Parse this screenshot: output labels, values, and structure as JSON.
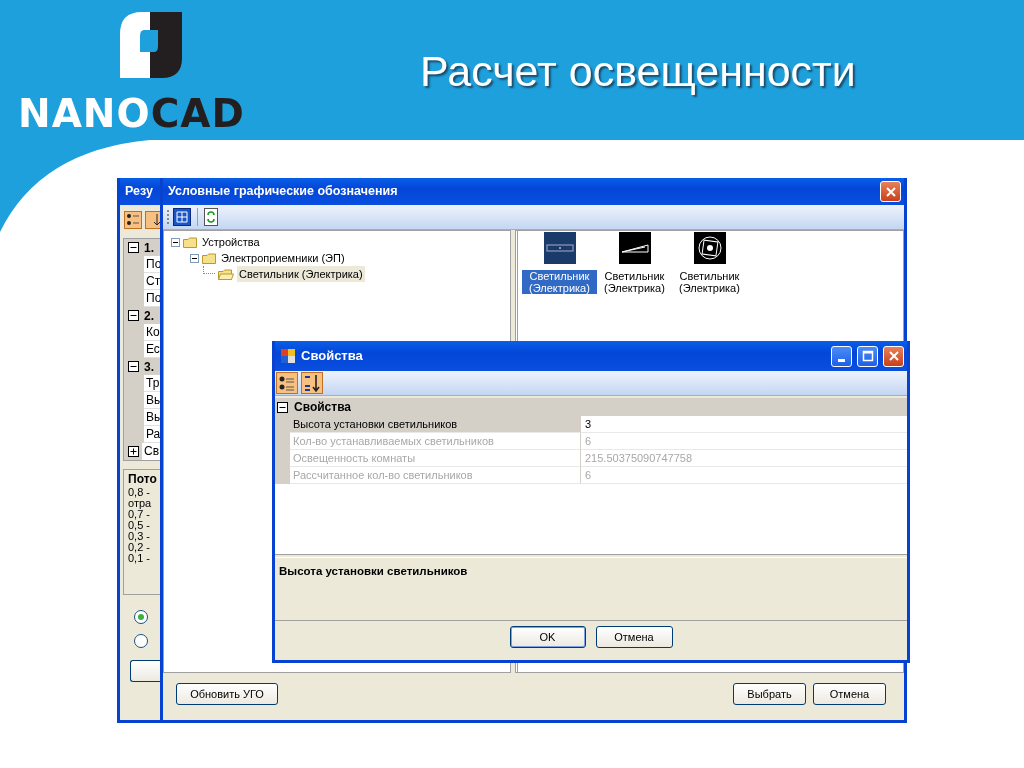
{
  "slide": {
    "title": "Расчет освещенности",
    "logo": {
      "light": "NANO",
      "dark": "CAD"
    }
  },
  "results_window": {
    "title": "Резу",
    "rows": [
      {
        "kind": "category",
        "label": "1.",
        "expanded": true
      },
      {
        "kind": "property",
        "label": "По"
      },
      {
        "kind": "property",
        "label": "Ст"
      },
      {
        "kind": "property",
        "label": "По"
      },
      {
        "kind": "category",
        "label": "2.",
        "expanded": true
      },
      {
        "kind": "property",
        "label": "Ко"
      },
      {
        "kind": "property",
        "label": "Ес"
      },
      {
        "kind": "category",
        "label": "3.",
        "expanded": true
      },
      {
        "kind": "property",
        "label": "Тр"
      },
      {
        "kind": "property",
        "label": "Вы"
      },
      {
        "kind": "property",
        "label": "Вы"
      },
      {
        "kind": "property",
        "label": "Ра"
      },
      {
        "kind": "category",
        "label": "Св",
        "expanded": false
      }
    ],
    "description": {
      "title": "Пото",
      "lines": [
        "0,8 -",
        "отра",
        "0,7 -",
        "0,5 -",
        "0,3 -",
        "0,2 -",
        "0,1 -"
      ]
    },
    "radios": [
      {
        "selected": true
      },
      {
        "selected": false
      }
    ]
  },
  "symbols_window": {
    "title": "Условные графические обозначения",
    "tree": [
      {
        "label": "Устройства",
        "expanded": true,
        "selected": false,
        "children": [
          {
            "label": "Электроприемники (ЭП)",
            "expanded": true,
            "selected": false,
            "children": [
              {
                "label": "Светильник (Электрика)",
                "selected": true
              }
            ]
          }
        ]
      }
    ],
    "symbols": [
      {
        "kind": "panel",
        "label": "Светильник (Электрика)",
        "selected": true
      },
      {
        "kind": "wedge",
        "label": "Светильник (Электрика)",
        "selected": false
      },
      {
        "kind": "ring",
        "label": "Светильник (Электрика)",
        "selected": false
      }
    ],
    "buttons_left": [
      "Обновить УГО"
    ],
    "buttons_right": [
      "Выбрать",
      "Отмена"
    ]
  },
  "properties_window": {
    "title": "Свойства",
    "category": {
      "label": "Свойства",
      "expanded": true
    },
    "rows": [
      {
        "label": "Высота установки светильников",
        "value": "3",
        "disabled": false,
        "selected": true
      },
      {
        "label": "Кол-во устанавливаемых светильников",
        "value": "6",
        "disabled": true,
        "selected": false
      },
      {
        "label": "Освещенность комнаты",
        "value": "215.50375090747758",
        "disabled": true,
        "selected": false
      },
      {
        "label": "Рассчитанное кол-во светильников",
        "value": "6",
        "disabled": true,
        "selected": false
      }
    ],
    "description": {
      "title": "Высота установки светильников"
    },
    "buttons": [
      "OK",
      "Отмена"
    ]
  }
}
